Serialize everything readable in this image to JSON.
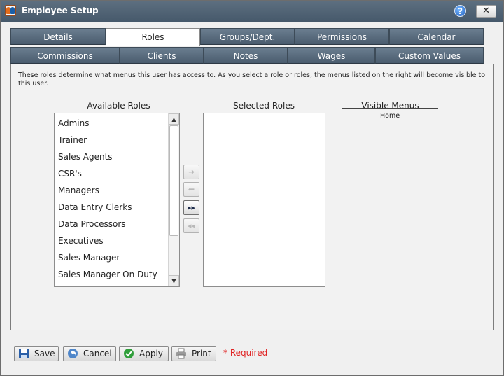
{
  "window": {
    "title": "Employee Setup",
    "help_glyph": "?",
    "close_glyph": "✕"
  },
  "tabs_row1": [
    {
      "label": "Details"
    },
    {
      "label": "Roles"
    },
    {
      "label": "Groups/Dept."
    },
    {
      "label": "Permissions"
    },
    {
      "label": "Calendar"
    }
  ],
  "tabs_row2": [
    {
      "label": "Commissions"
    },
    {
      "label": "Clients"
    },
    {
      "label": "Notes"
    },
    {
      "label": "Wages"
    },
    {
      "label": "Custom Values"
    }
  ],
  "active_tab": "Roles",
  "roles_panel": {
    "description": "These roles determine what menus this user has access to. As you select a role or roles, the menus listed on the right will become visible to this user.",
    "available_title": "Available Roles",
    "selected_title": "Selected Roles",
    "visible_menus_title": "Visible Menus",
    "available_roles": [
      "Admins",
      "Trainer",
      "Sales Agents",
      "CSR's",
      "Managers",
      "Data Entry Clerks",
      "Data Processors",
      "Executives",
      "Sales Manager",
      "Sales Manager On Duty"
    ],
    "selected_roles": [],
    "visible_menus": [
      "Home"
    ],
    "movers": [
      {
        "icon": "arrow-right-icon",
        "glyph": "➜",
        "enabled": false
      },
      {
        "icon": "arrow-left-icon",
        "glyph": "⬅",
        "enabled": false
      },
      {
        "icon": "double-arrow-right-icon",
        "glyph": "▸▸",
        "enabled": true
      },
      {
        "icon": "double-arrow-left-icon",
        "glyph": "◂◂",
        "enabled": false
      }
    ]
  },
  "footer": {
    "save_label": "Save",
    "cancel_label": "Cancel",
    "apply_label": "Apply",
    "print_label": "Print",
    "required_note": "* Required"
  },
  "colors": {
    "titlebar": "#4f6274",
    "tab": "#5a6d80",
    "required": "#e02020"
  }
}
